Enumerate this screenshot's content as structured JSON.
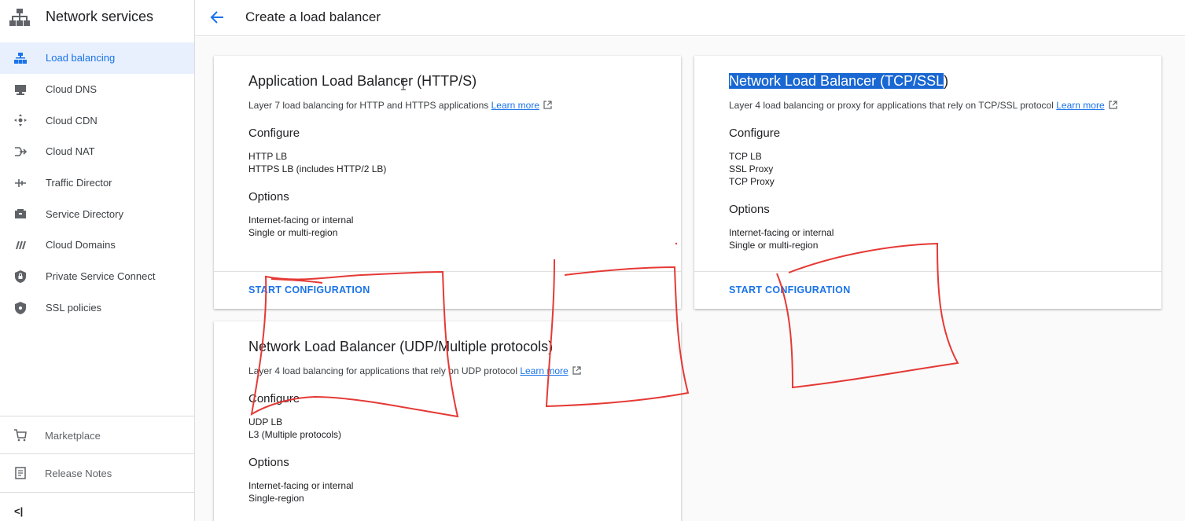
{
  "sidebar": {
    "title": "Network services",
    "items": [
      {
        "label": "Load balancing",
        "icon": "load-balancing-icon",
        "active": true
      },
      {
        "label": "Cloud DNS",
        "icon": "cloud-dns-icon"
      },
      {
        "label": "Cloud CDN",
        "icon": "cloud-cdn-icon"
      },
      {
        "label": "Cloud NAT",
        "icon": "cloud-nat-icon"
      },
      {
        "label": "Traffic Director",
        "icon": "traffic-director-icon"
      },
      {
        "label": "Service Directory",
        "icon": "service-directory-icon"
      },
      {
        "label": "Cloud Domains",
        "icon": "cloud-domains-icon"
      },
      {
        "label": "Private Service Connect",
        "icon": "private-service-connect-icon"
      },
      {
        "label": "SSL policies",
        "icon": "ssl-policies-icon"
      }
    ],
    "marketplace": "Marketplace",
    "release_notes": "Release Notes",
    "collapse": "<|"
  },
  "header": {
    "title": "Create a load balancer"
  },
  "cards": {
    "http": {
      "title": "Application Load Balancer (HTTP/S)",
      "desc": "Layer 7 load balancing for HTTP and HTTPS applications",
      "learn_more": "Learn more",
      "configure_heading": "Configure",
      "configure": [
        "HTTP LB",
        "HTTPS LB (includes HTTP/2 LB)"
      ],
      "options_heading": "Options",
      "options": [
        "Internet-facing or internal",
        "Single or multi-region"
      ],
      "button": "START CONFIGURATION"
    },
    "tcp": {
      "title_selected": "Network Load Balancer (TCP/SSL",
      "title_rest": ")",
      "desc": "Layer 4 load balancing or proxy for applications that rely on TCP/SSL protocol",
      "learn_more": "Learn more",
      "configure_heading": "Configure",
      "configure": [
        "TCP LB",
        "SSL Proxy",
        "TCP Proxy"
      ],
      "options_heading": "Options",
      "options": [
        "Internet-facing or internal",
        "Single or multi-region"
      ],
      "button": "START CONFIGURATION"
    },
    "udp": {
      "title": "Network Load Balancer (UDP/Multiple protocols)",
      "desc": "Layer 4 load balancing for applications that rely on UDP protocol",
      "learn_more": "Learn more",
      "configure_heading": "Configure",
      "configure": [
        "UDP LB",
        "L3 (Multiple protocols)"
      ],
      "options_heading": "Options",
      "options": [
        "Internet-facing or internal",
        "Single-region"
      ]
    }
  },
  "colors": {
    "accent": "#1a73e8",
    "annotation": "#e53935",
    "active_bg": "#e8f0fe"
  }
}
